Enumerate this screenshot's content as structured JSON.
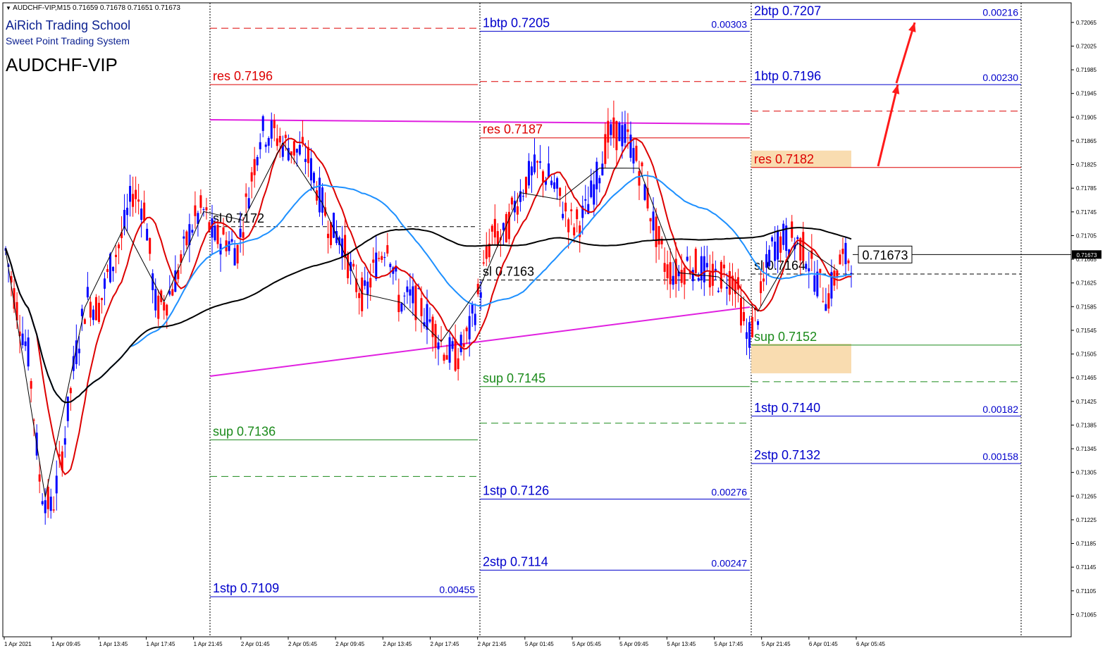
{
  "header": {
    "ohlc": "AUDCHF-VIP,M15  0.71659 0.71678 0.71651 0.71673",
    "brand_title": "AiRich Trading School",
    "brand_subtitle": "Sweet Point Trading System",
    "symbol": "AUDCHF-VIP"
  },
  "colors": {
    "resistance": "#dd0000",
    "support": "#1a8a1a",
    "target": "#0000cc",
    "stoploss": "#000000",
    "trendline": "#e020e0",
    "ma_fast": "#dd0000",
    "ma_mid": "#1e90ff",
    "ma_slow": "#000000",
    "bull_candle": "#0000ff",
    "bear_candle": "#ff0000",
    "zone_fill": "#f9dcb0",
    "arrow": "#ff1a1a"
  },
  "chart_data": {
    "type": "candlestick",
    "symbol": "AUDCHF-VIP",
    "timeframe": "M15",
    "ylim": [
      0.7105,
      0.72085
    ],
    "y_ticks": [
      "0.72065",
      "0.72025",
      "0.71985",
      "0.71945",
      "0.71905",
      "0.71865",
      "0.71825",
      "0.71785",
      "0.71745",
      "0.71705",
      "0.71665",
      "0.71625",
      "0.71585",
      "0.71545",
      "0.71505",
      "0.71465",
      "0.71425",
      "0.71385",
      "0.71345",
      "0.71305",
      "0.71265",
      "0.71225",
      "0.71185",
      "0.71145",
      "0.71105",
      "0.71065"
    ],
    "x_ticks": [
      "1 Apr 2021",
      "1 Apr 09:45",
      "1 Apr 13:45",
      "1 Apr 17:45",
      "1 Apr 21:45",
      "2 Apr 01:45",
      "2 Apr 05:45",
      "2 Apr 09:45",
      "2 Apr 13:45",
      "2 Apr 17:45",
      "2 Apr 21:45",
      "5 Apr 01:45",
      "5 Apr 05:45",
      "5 Apr 09:45",
      "5 Apr 13:45",
      "5 Apr 17:45",
      "5 Apr 21:45",
      "6 Apr 01:45",
      "6 Apr 05:45"
    ],
    "current_price": "0.71673",
    "price_path": [
      0.7168,
      0.7158,
      0.715,
      0.7128,
      0.7124,
      0.7135,
      0.715,
      0.716,
      0.7158,
      0.7165,
      0.717,
      0.7178,
      0.7175,
      0.7158,
      0.716,
      0.7165,
      0.7172,
      0.7175,
      0.717,
      0.717,
      0.7168,
      0.7178,
      0.7188,
      0.7188,
      0.7186,
      0.7185,
      0.7184,
      0.7178,
      0.7172,
      0.717,
      0.7163,
      0.716,
      0.7166,
      0.717,
      0.7159,
      0.716,
      0.7158,
      0.7155,
      0.7151,
      0.715,
      0.7154,
      0.7162,
      0.7171,
      0.717,
      0.7176,
      0.718,
      0.7182,
      0.718,
      0.7176,
      0.7172,
      0.7174,
      0.718,
      0.7187,
      0.7188,
      0.7186,
      0.718,
      0.7172,
      0.7165,
      0.7164,
      0.7166,
      0.7165,
      0.7163,
      0.7164,
      0.7163,
      0.7153,
      0.7158,
      0.7168,
      0.717,
      0.717,
      0.7168,
      0.7163,
      0.716,
      0.7166,
      0.7167
    ],
    "sessions": [
      {
        "levels": [
          {
            "kind": "res",
            "text": "res 0.7196",
            "price": 0.7196
          },
          {
            "kind": "sup",
            "text": "sup 0.7136",
            "price": 0.7136
          },
          {
            "kind": "target",
            "text": "1stp 0.7109",
            "price": 0.71095,
            "pips": "0.00455"
          },
          {
            "kind": "stoploss",
            "text": "sl 0.7172",
            "price": 0.7172
          }
        ]
      },
      {
        "levels": [
          {
            "kind": "target",
            "text": "1btp 0.7205",
            "price": 0.7205,
            "pips": "0.00303"
          },
          {
            "kind": "res",
            "text": "res 0.7187",
            "price": 0.7187
          },
          {
            "kind": "sup",
            "text": "sup 0.7145",
            "price": 0.7145
          },
          {
            "kind": "target",
            "text": "1stp 0.7126",
            "price": 0.7126,
            "pips": "0.00276"
          },
          {
            "kind": "target",
            "text": "2stp 0.7114",
            "price": 0.7114,
            "pips": "0.00247"
          },
          {
            "kind": "stoploss",
            "text": "sl 0.7163",
            "price": 0.7163
          }
        ]
      },
      {
        "levels": [
          {
            "kind": "target",
            "text": "2btp 0.7207",
            "price": 0.7207,
            "pips": "0.00216"
          },
          {
            "kind": "target",
            "text": "1btp 0.7196",
            "price": 0.7196,
            "pips": "0.00230"
          },
          {
            "kind": "res",
            "text": "res 0.7182",
            "price": 0.7182,
            "zone": true
          },
          {
            "kind": "sup",
            "text": "sup 0.7152",
            "price": 0.7152,
            "zone": true
          },
          {
            "kind": "target",
            "text": "1stp 0.7140",
            "price": 0.714,
            "pips": "0.00182"
          },
          {
            "kind": "target",
            "text": "2stp 0.7132",
            "price": 0.7132,
            "pips": "0.00158"
          },
          {
            "kind": "stoploss",
            "text": "sl 0.7164",
            "price": 0.7164
          }
        ]
      }
    ]
  }
}
